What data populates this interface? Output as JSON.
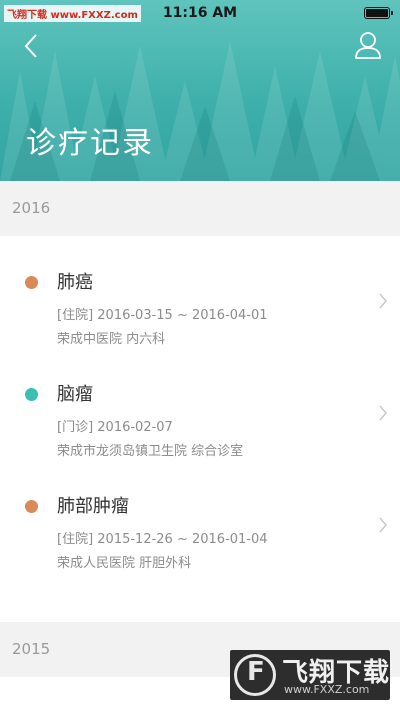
{
  "status_bar": {
    "watermark": "飞翔下载 www.FXXZ.com",
    "time": "11:16 AM"
  },
  "header": {
    "title": "诊疗记录",
    "back_icon": "chevron-left-icon",
    "user_icon": "user-icon"
  },
  "years": [
    {
      "year": "2016",
      "records": [
        {
          "name": "肺癌",
          "visit": "[住院] 2016-03-15 ~ 2016-04-01",
          "hospital": "荣成中医院 内六科",
          "dot_color": "#d9895a"
        },
        {
          "name": "脑瘤",
          "visit": "[门诊] 2016-02-07",
          "hospital": "荣成市龙须岛镇卫生院 综合诊室",
          "dot_color": "#3cbfb3"
        },
        {
          "name": "肺部肿瘤",
          "visit": "[住院] 2015-12-26 ~ 2016-01-04",
          "hospital": "荣成人民医院 肝胆外科",
          "dot_color": "#d9895a"
        }
      ]
    },
    {
      "year": "2015",
      "records": []
    }
  ],
  "watermark_br": {
    "name": "飞翔下载",
    "url": "www.FXXZ.com"
  },
  "colors": {
    "header": "#3fb0ab",
    "accent_orange": "#d9895a",
    "accent_teal": "#3cbfb3"
  }
}
